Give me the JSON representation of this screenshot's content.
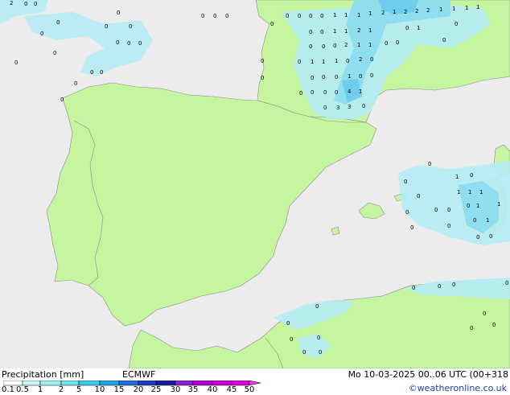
{
  "legend": {
    "title": "Precipitation [mm]",
    "model": "ECMWF",
    "valid_time": "Mo 10-03-2025 00..06 UTC (00+318",
    "copyright": "©weatheronline.co.uk",
    "scale": [
      {
        "label": "0.1",
        "color": "#ffffff"
      },
      {
        "label": "0.5",
        "color": "#c8f6f6"
      },
      {
        "label": "1",
        "color": "#9ef0f0"
      },
      {
        "label": "2",
        "color": "#6ee3f0"
      },
      {
        "label": "5",
        "color": "#3cc8ea"
      },
      {
        "label": "10",
        "color": "#1fa5e3"
      },
      {
        "label": "15",
        "color": "#1f6fd0"
      },
      {
        "label": "20",
        "color": "#1f3fbc"
      },
      {
        "label": "25",
        "color": "#16209a"
      },
      {
        "label": "30",
        "color": "#9020d8"
      },
      {
        "label": "35",
        "color": "#b400d8"
      },
      {
        "label": "40",
        "color": "#d000d0"
      },
      {
        "label": "45",
        "color": "#e200d8"
      },
      {
        "label": "50",
        "color": "#f23ce6"
      }
    ]
  },
  "colors": {
    "sea": "#ececec",
    "land": "#c6f5a0",
    "border": "#8c8c8c",
    "light_precip": "#b4ecf4",
    "moderate_precip": "#8adcf0",
    "heavy_precip": "#6ccbeb"
  },
  "station_values": [
    "2",
    "0",
    "0",
    "1",
    "1",
    "2",
    "1",
    "1",
    "1",
    "2",
    "2",
    "2",
    "1",
    "1",
    "1",
    "1",
    "0",
    "1",
    "1",
    "1",
    "0",
    "0",
    "2",
    "1",
    "1",
    "1",
    "1",
    "1",
    "0",
    "3",
    "0",
    "1",
    "1",
    "1",
    "1",
    "1",
    "1",
    "1",
    "1",
    "1",
    "1",
    "1",
    "1",
    "1",
    "1",
    "1",
    "1",
    "1",
    "1",
    "1",
    "1",
    "1",
    "1",
    "1",
    "1",
    "1",
    "1",
    "1",
    "1",
    "1",
    "1",
    "1"
  ]
}
